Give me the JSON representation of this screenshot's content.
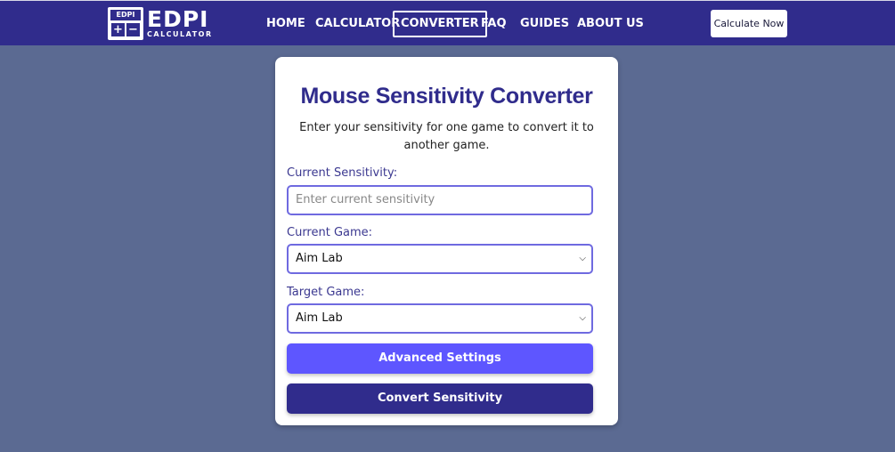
{
  "logo": {
    "badge_top": "EDPI",
    "badge_plus": "+",
    "badge_minus": "−",
    "title": "EDPI",
    "subtitle": "CALCULATOR"
  },
  "nav": {
    "items": [
      {
        "label": "HOME",
        "active": false
      },
      {
        "label": "CALCULATOR",
        "active": false
      },
      {
        "label": "CONVERTER",
        "active": true
      },
      {
        "label": "FAQ",
        "active": false
      },
      {
        "label": "GUIDES",
        "active": false
      },
      {
        "label": "ABOUT US",
        "active": false
      }
    ],
    "cta_label": "Calculate Now"
  },
  "converter": {
    "title": "Mouse Sensitivity Converter",
    "description": "Enter your sensitivity for one game to convert it to another game.",
    "current_sensitivity_label": "Current Sensitivity:",
    "current_sensitivity_placeholder": "Enter current sensitivity",
    "current_sensitivity_value": "",
    "current_game_label": "Current Game:",
    "current_game_value": "Aim Lab",
    "target_game_label": "Target Game:",
    "target_game_value": "Aim Lab",
    "advanced_button_label": "Advanced Settings",
    "convert_button_label": "Convert Sensitivity"
  },
  "colors": {
    "navbar": "#302c8c",
    "background": "#5b6a92",
    "accent": "#5e56ff",
    "primary_button": "#302c8c"
  }
}
